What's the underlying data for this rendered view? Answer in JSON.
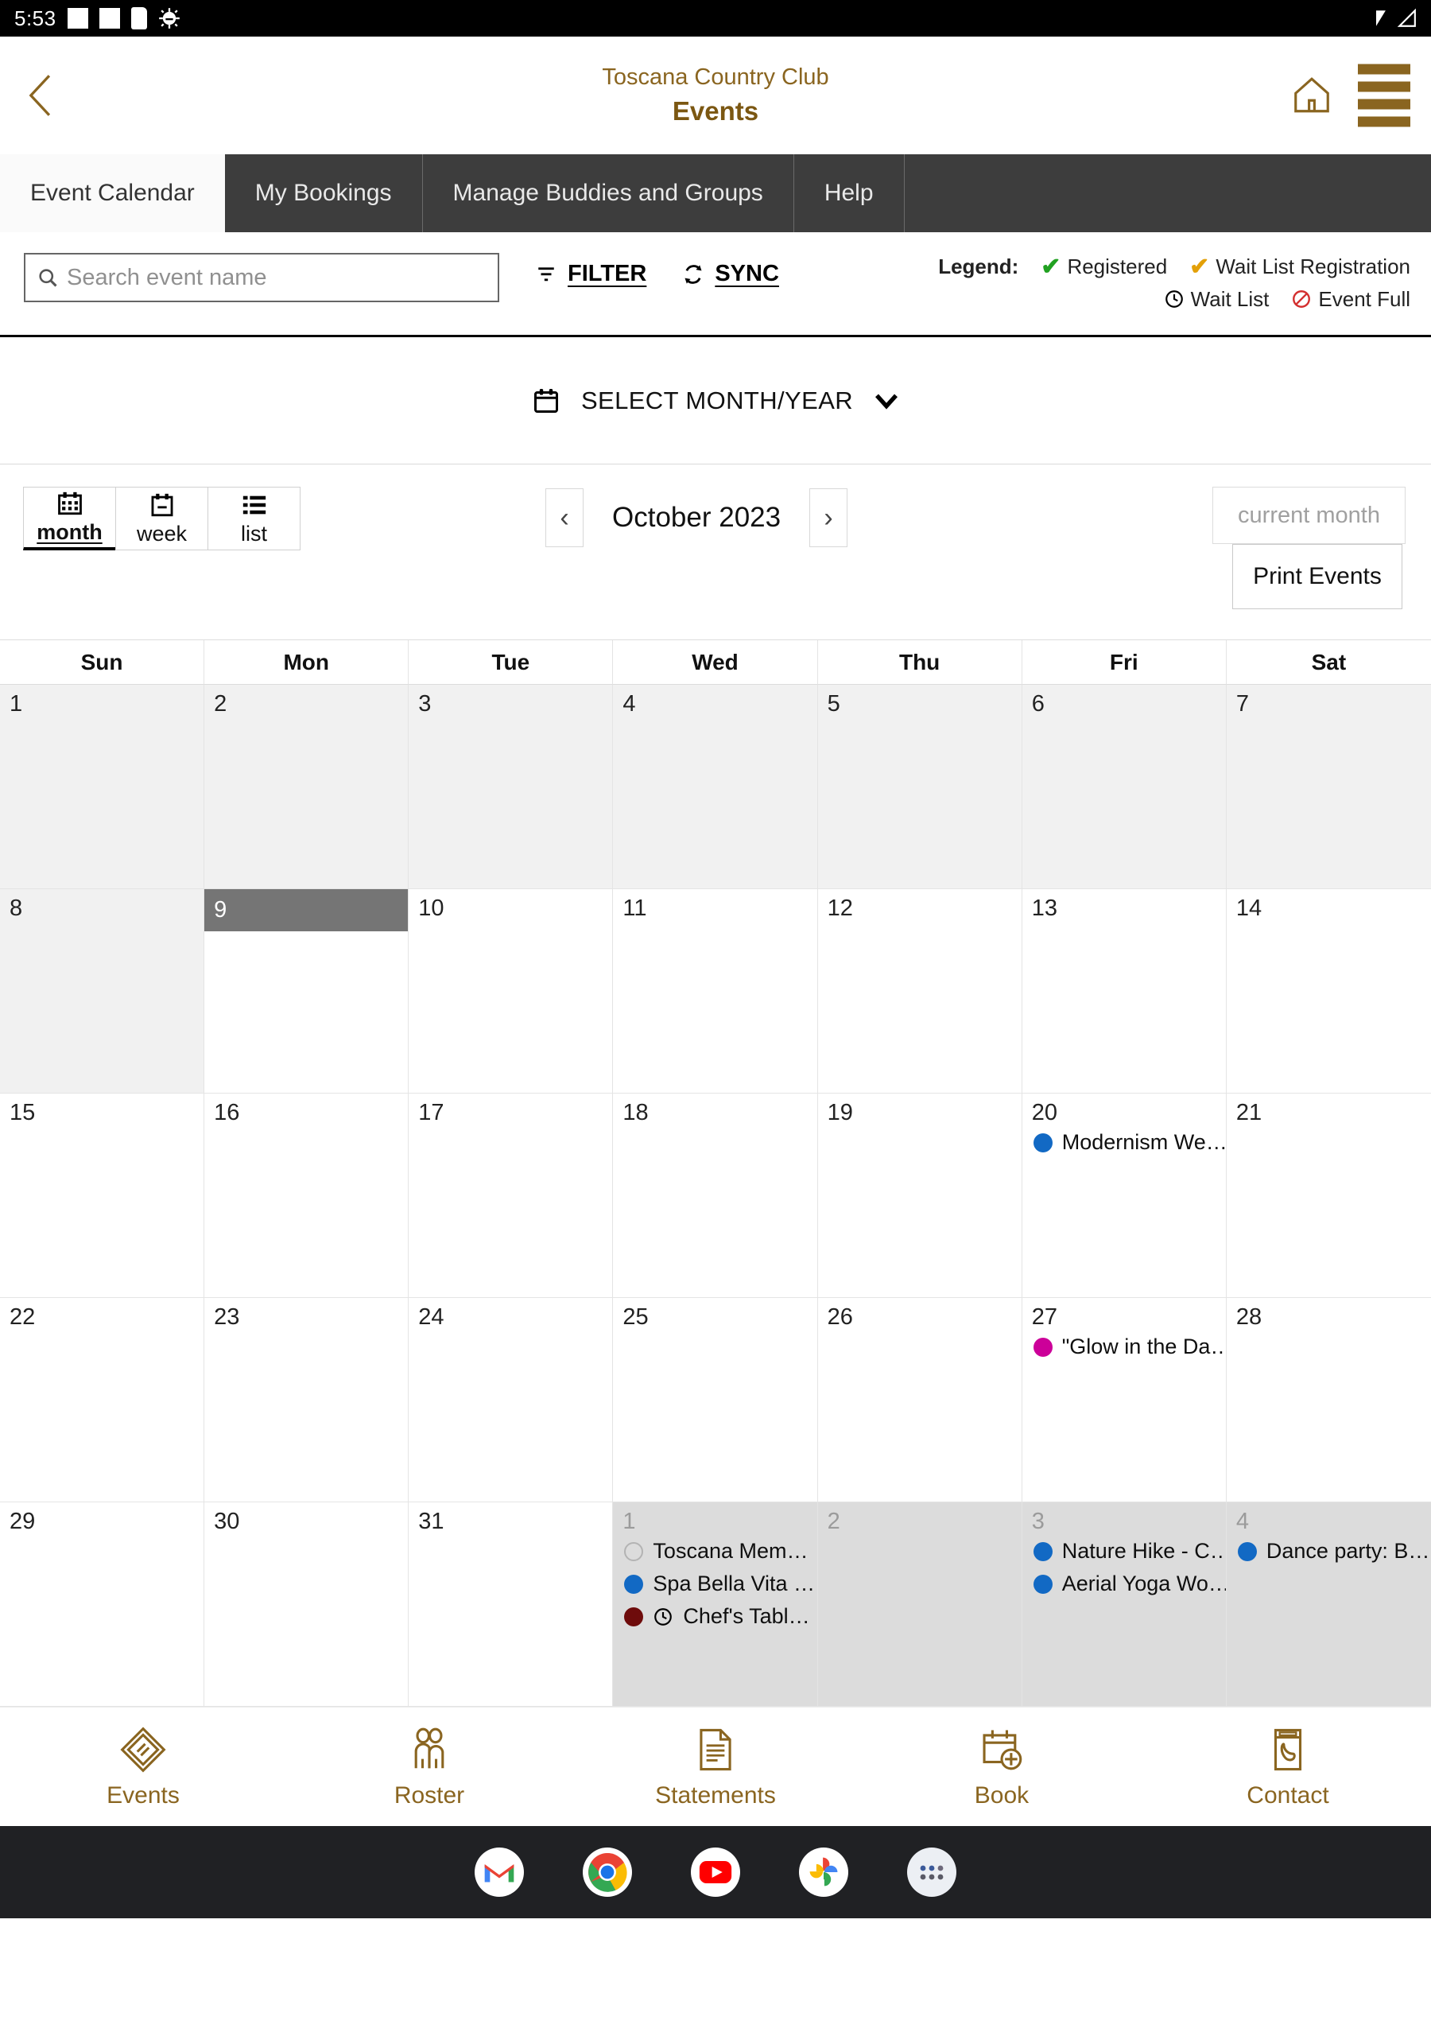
{
  "status_bar": {
    "time": "5:53",
    "icons": [
      "square-icon",
      "square-icon",
      "sd-card-icon",
      "android-debug-icon"
    ],
    "right_icons": [
      "wifi-icon",
      "signal-icon"
    ]
  },
  "app_header": {
    "back_label": "back-chevron",
    "club_name": "Toscana Country Club",
    "page_title": "Events",
    "home_icon": "home-icon",
    "menu_icon": "hamburger-menu-icon"
  },
  "tabs": [
    {
      "label": "Event Calendar",
      "active": true
    },
    {
      "label": "My Bookings",
      "active": false
    },
    {
      "label": "Manage Buddies and Groups",
      "active": false
    },
    {
      "label": "Help",
      "active": false
    }
  ],
  "toolbar": {
    "search_placeholder": "Search event name",
    "search_value": "",
    "filter_label": "FILTER",
    "sync_label": "SYNC"
  },
  "legend": {
    "title": "Legend:",
    "items": [
      {
        "label": "Registered",
        "marker": "check",
        "color": "#21a121"
      },
      {
        "label": "Wait List Registration",
        "marker": "check",
        "color": "#e3a008"
      },
      {
        "label": "Wait List",
        "marker": "clock",
        "color": "#000000"
      },
      {
        "label": "Event Full",
        "marker": "no-entry",
        "color": "#d32f2f"
      }
    ]
  },
  "month_select": {
    "label": "SELECT MONTH/YEAR",
    "calendar_icon": "calendar-icon",
    "chevron_icon": "chevron-down-icon"
  },
  "view_toggle": {
    "options": [
      {
        "label": "month",
        "selected": true,
        "icon": "calendar-grid-icon"
      },
      {
        "label": "week",
        "selected": false,
        "icon": "calendar-week-icon"
      },
      {
        "label": "list",
        "selected": false,
        "icon": "list-icon"
      }
    ]
  },
  "navigation": {
    "prev_label": "‹",
    "next_label": "›",
    "title": "October 2023",
    "current_month_label": "current month",
    "print_label": "Print Events"
  },
  "calendar": {
    "day_names": [
      "Sun",
      "Mon",
      "Tue",
      "Wed",
      "Thu",
      "Fri",
      "Sat"
    ],
    "weeks": [
      [
        {
          "day": "1",
          "state": "shade",
          "events": []
        },
        {
          "day": "2",
          "state": "shade",
          "events": []
        },
        {
          "day": "3",
          "state": "shade",
          "events": []
        },
        {
          "day": "4",
          "state": "shade",
          "events": []
        },
        {
          "day": "5",
          "state": "shade",
          "events": []
        },
        {
          "day": "6",
          "state": "shade",
          "events": []
        },
        {
          "day": "7",
          "state": "shade",
          "events": []
        }
      ],
      [
        {
          "day": "8",
          "state": "shade",
          "events": []
        },
        {
          "day": "9",
          "state": "today",
          "events": []
        },
        {
          "day": "10",
          "state": "normal",
          "events": []
        },
        {
          "day": "11",
          "state": "normal",
          "events": []
        },
        {
          "day": "12",
          "state": "normal",
          "events": []
        },
        {
          "day": "13",
          "state": "normal",
          "events": []
        },
        {
          "day": "14",
          "state": "normal",
          "events": []
        }
      ],
      [
        {
          "day": "15",
          "state": "normal",
          "events": []
        },
        {
          "day": "16",
          "state": "normal",
          "events": []
        },
        {
          "day": "17",
          "state": "normal",
          "events": []
        },
        {
          "day": "18",
          "state": "normal",
          "events": []
        },
        {
          "day": "19",
          "state": "normal",
          "events": []
        },
        {
          "day": "20",
          "state": "normal",
          "events": [
            {
              "title": "Modernism We…",
              "dot_color": "#1269c4",
              "marker": "none"
            }
          ]
        },
        {
          "day": "21",
          "state": "normal",
          "events": []
        }
      ],
      [
        {
          "day": "22",
          "state": "normal",
          "events": []
        },
        {
          "day": "23",
          "state": "normal",
          "events": []
        },
        {
          "day": "24",
          "state": "normal",
          "events": []
        },
        {
          "day": "25",
          "state": "normal",
          "events": []
        },
        {
          "day": "26",
          "state": "normal",
          "events": []
        },
        {
          "day": "27",
          "state": "normal",
          "events": [
            {
              "title": "\"Glow in the Da…",
              "dot_color": "#cc0099",
              "marker": "none"
            }
          ]
        },
        {
          "day": "28",
          "state": "normal",
          "events": []
        }
      ],
      [
        {
          "day": "29",
          "state": "normal",
          "events": []
        },
        {
          "day": "30",
          "state": "normal",
          "events": []
        },
        {
          "day": "31",
          "state": "normal",
          "events": []
        },
        {
          "day": "1",
          "state": "other",
          "events": [
            {
              "title": "Toscana Mem…",
              "dot_color": "hollow",
              "marker": "none"
            },
            {
              "title": "Spa Bella Vita …",
              "dot_color": "#1269c4",
              "marker": "none"
            },
            {
              "title": "Chef's Tabl…",
              "dot_color": "#6e0b0b",
              "marker": "clock"
            }
          ]
        },
        {
          "day": "2",
          "state": "other",
          "events": []
        },
        {
          "day": "3",
          "state": "other",
          "events": [
            {
              "title": "Nature Hike - C…",
              "dot_color": "#1269c4",
              "marker": "none"
            },
            {
              "title": "Aerial Yoga Wo…",
              "dot_color": "#1269c4",
              "marker": "none"
            }
          ]
        },
        {
          "day": "4",
          "state": "other",
          "events": [
            {
              "title": "Dance party: B…",
              "dot_color": "#1269c4",
              "marker": "none"
            }
          ]
        }
      ]
    ]
  },
  "bottom_nav": [
    {
      "label": "Events",
      "icon": "ticket-icon"
    },
    {
      "label": "Roster",
      "icon": "people-icon"
    },
    {
      "label": "Statements",
      "icon": "document-icon"
    },
    {
      "label": "Book",
      "icon": "calendar-add-icon"
    },
    {
      "label": "Contact",
      "icon": "phone-card-icon"
    }
  ],
  "dock": [
    {
      "name": "gmail-icon"
    },
    {
      "name": "chrome-icon"
    },
    {
      "name": "youtube-icon"
    },
    {
      "name": "google-photos-icon"
    },
    {
      "name": "app-drawer-icon"
    }
  ],
  "colors": {
    "brand_gold": "#8a6520",
    "tab_bar": "#3d3d3d",
    "today_highlight": "#757575",
    "event_blue": "#1269c4",
    "event_magenta": "#cc0099",
    "event_maroon": "#6e0b0b"
  }
}
